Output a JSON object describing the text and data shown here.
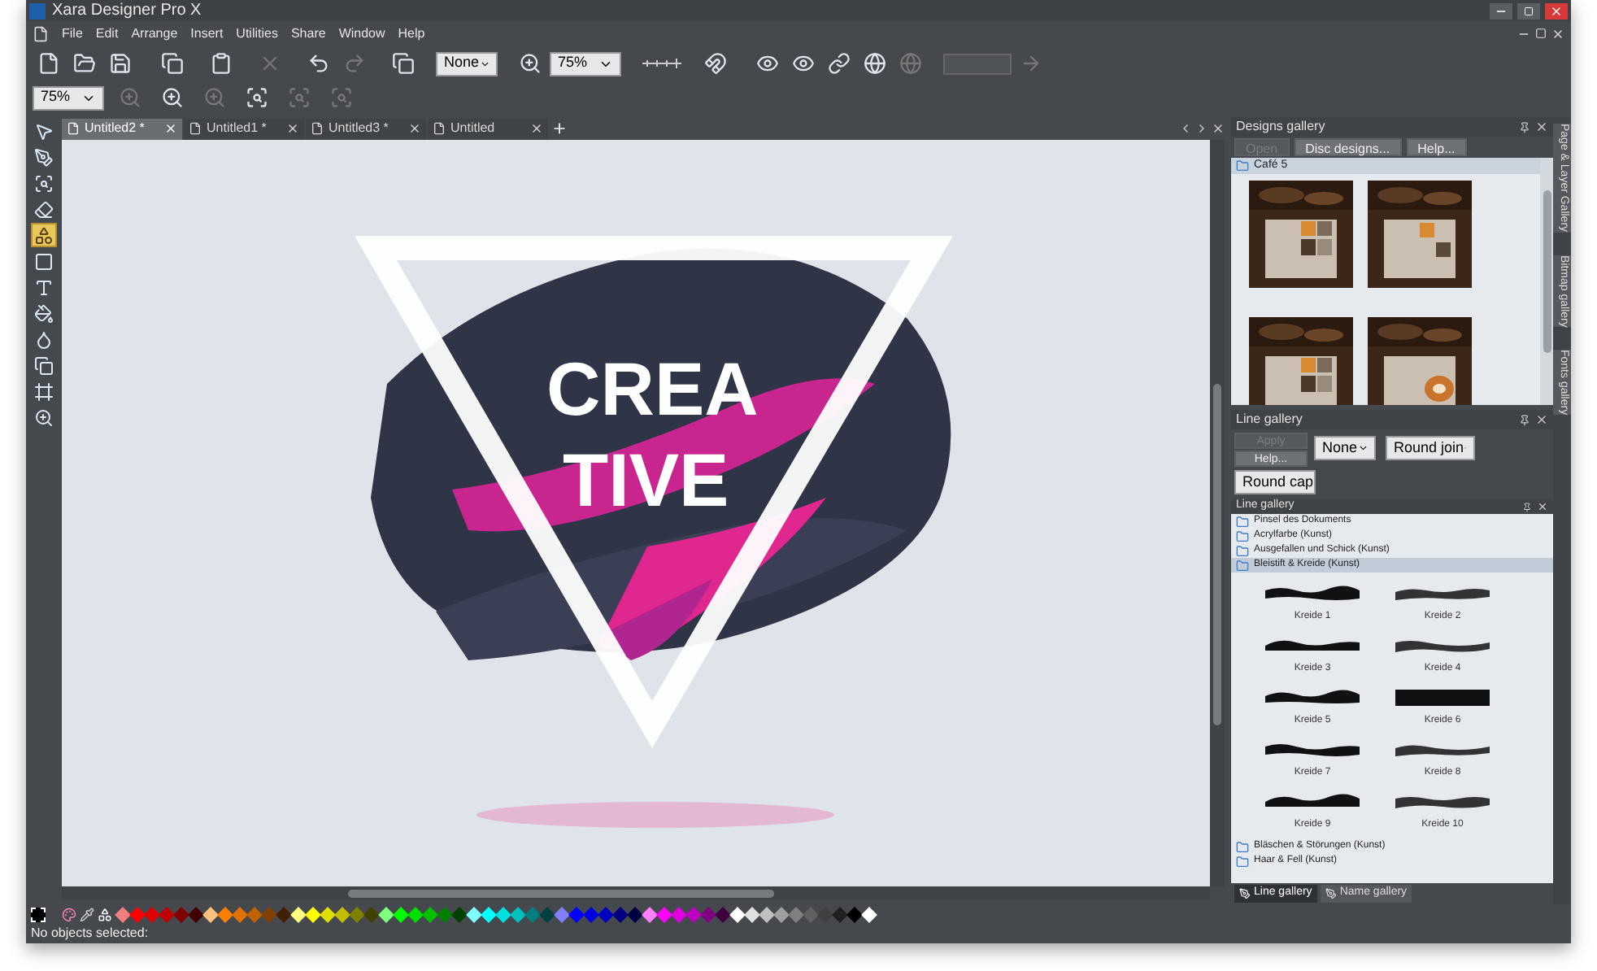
{
  "window": {
    "title": "Xara Designer Pro X"
  },
  "menu": [
    "File",
    "Edit",
    "Arrange",
    "Insert",
    "Utilities",
    "Share",
    "Window",
    "Help"
  ],
  "toolbar": {
    "line_width": "None",
    "zoom": "75%"
  },
  "toolbar2": {
    "zoom": "75%"
  },
  "tools": [
    {
      "kind": "select",
      "selected": false
    },
    {
      "kind": "pen",
      "selected": false
    },
    {
      "kind": "contour",
      "selected": false
    },
    {
      "kind": "eraser",
      "selected": false
    },
    {
      "kind": "shape",
      "selected": true
    },
    {
      "kind": "rectangle",
      "selected": false
    },
    {
      "kind": "text",
      "selected": false
    },
    {
      "kind": "fill",
      "selected": false
    },
    {
      "kind": "transparency",
      "selected": false
    },
    {
      "kind": "shadow",
      "selected": false
    },
    {
      "kind": "frame",
      "selected": false
    },
    {
      "kind": "zoom",
      "selected": false
    }
  ],
  "doc_tabs": [
    {
      "label": "Untitled2 *",
      "selected": true
    },
    {
      "label": "Untitled1 *",
      "selected": false
    },
    {
      "label": "Untitled3 *",
      "selected": false
    },
    {
      "label": "Untitled",
      "selected": false
    }
  ],
  "artwork": {
    "lines": [
      "CREA",
      "TIVE"
    ]
  },
  "designs_gallery": {
    "title": "Designs gallery",
    "buttons": [
      {
        "label": "Open",
        "disabled": true
      },
      {
        "label": "Disc designs...",
        "disabled": false
      },
      {
        "label": "Help...",
        "disabled": false
      }
    ],
    "folder": "Café 5"
  },
  "line_gallery": {
    "title": "Line gallery",
    "buttons": [
      {
        "label": "Apply",
        "disabled": true
      },
      {
        "label": "Help...",
        "disabled": false
      }
    ],
    "dropdowns": [
      "None",
      "Round join",
      "Round cap"
    ],
    "list_title": "Line gallery",
    "folders_before": [
      {
        "label": "Pinsel des Dokuments",
        "selected": false
      },
      {
        "label": "Acrylfarbe (Kunst)",
        "selected": false
      },
      {
        "label": "Ausgefallen und Schick (Kunst)",
        "selected": false
      },
      {
        "label": "Bleistift & Kreide (Kunst)",
        "selected": true
      }
    ],
    "items": [
      "Kreide 1",
      "Kreide 2",
      "Kreide 3",
      "Kreide 4",
      "Kreide 5",
      "Kreide 6",
      "Kreide 7",
      "Kreide 8",
      "Kreide 9",
      "Kreide 10"
    ],
    "folders_after": [
      {
        "label": "Bläschen & Störungen (Kunst)",
        "selected": false
      },
      {
        "label": "Haar & Fell (Kunst)",
        "selected": false
      }
    ]
  },
  "bottom_tabs": [
    {
      "label": "Line gallery",
      "selected": true
    },
    {
      "label": "Name gallery",
      "selected": false
    }
  ],
  "side_tabs": [
    "Page & Layer Gallery",
    "Bitmap gallery",
    "Fonts gallery"
  ],
  "palette": [
    {
      "color": "#f08080"
    },
    {
      "color": "#ff0000"
    },
    {
      "color": "#e00000"
    },
    {
      "color": "#c00000"
    },
    {
      "color": "#800000"
    },
    {
      "color": "#400000"
    },
    {
      "color": "#ffc080"
    },
    {
      "color": "#ff8000"
    },
    {
      "color": "#e07000"
    },
    {
      "color": "#c06000"
    },
    {
      "color": "#804000"
    },
    {
      "color": "#402000"
    },
    {
      "color": "#ffff80"
    },
    {
      "color": "#ffff00"
    },
    {
      "color": "#e0e000"
    },
    {
      "color": "#c0c000"
    },
    {
      "color": "#808000"
    },
    {
      "color": "#404000"
    },
    {
      "color": "#80ff80"
    },
    {
      "color": "#00ff00"
    },
    {
      "color": "#00e000"
    },
    {
      "color": "#00c000"
    },
    {
      "color": "#008000"
    },
    {
      "color": "#004000"
    },
    {
      "color": "#80ffff"
    },
    {
      "color": "#00ffff"
    },
    {
      "color": "#00e0e0"
    },
    {
      "color": "#00c0c0"
    },
    {
      "color": "#008080"
    },
    {
      "color": "#004040"
    },
    {
      "color": "#8080ff"
    },
    {
      "color": "#0000ff"
    },
    {
      "color": "#0000e0"
    },
    {
      "color": "#0000c0"
    },
    {
      "color": "#000080"
    },
    {
      "color": "#000040"
    },
    {
      "color": "#ff80ff"
    },
    {
      "color": "#ff00ff"
    },
    {
      "color": "#e000e0"
    },
    {
      "color": "#c000c0"
    },
    {
      "color": "#800080"
    },
    {
      "color": "#400040"
    },
    {
      "color": "#ffffff"
    },
    {
      "color": "#e0e0e0"
    },
    {
      "color": "#c0c0c0"
    },
    {
      "color": "#a0a0a0"
    },
    {
      "color": "#808080"
    },
    {
      "color": "#606060"
    },
    {
      "color": "#404040"
    },
    {
      "color": "#202020"
    },
    {
      "color": "#000000"
    },
    {
      "color": "#ffffff"
    }
  ],
  "status": "No objects selected:"
}
